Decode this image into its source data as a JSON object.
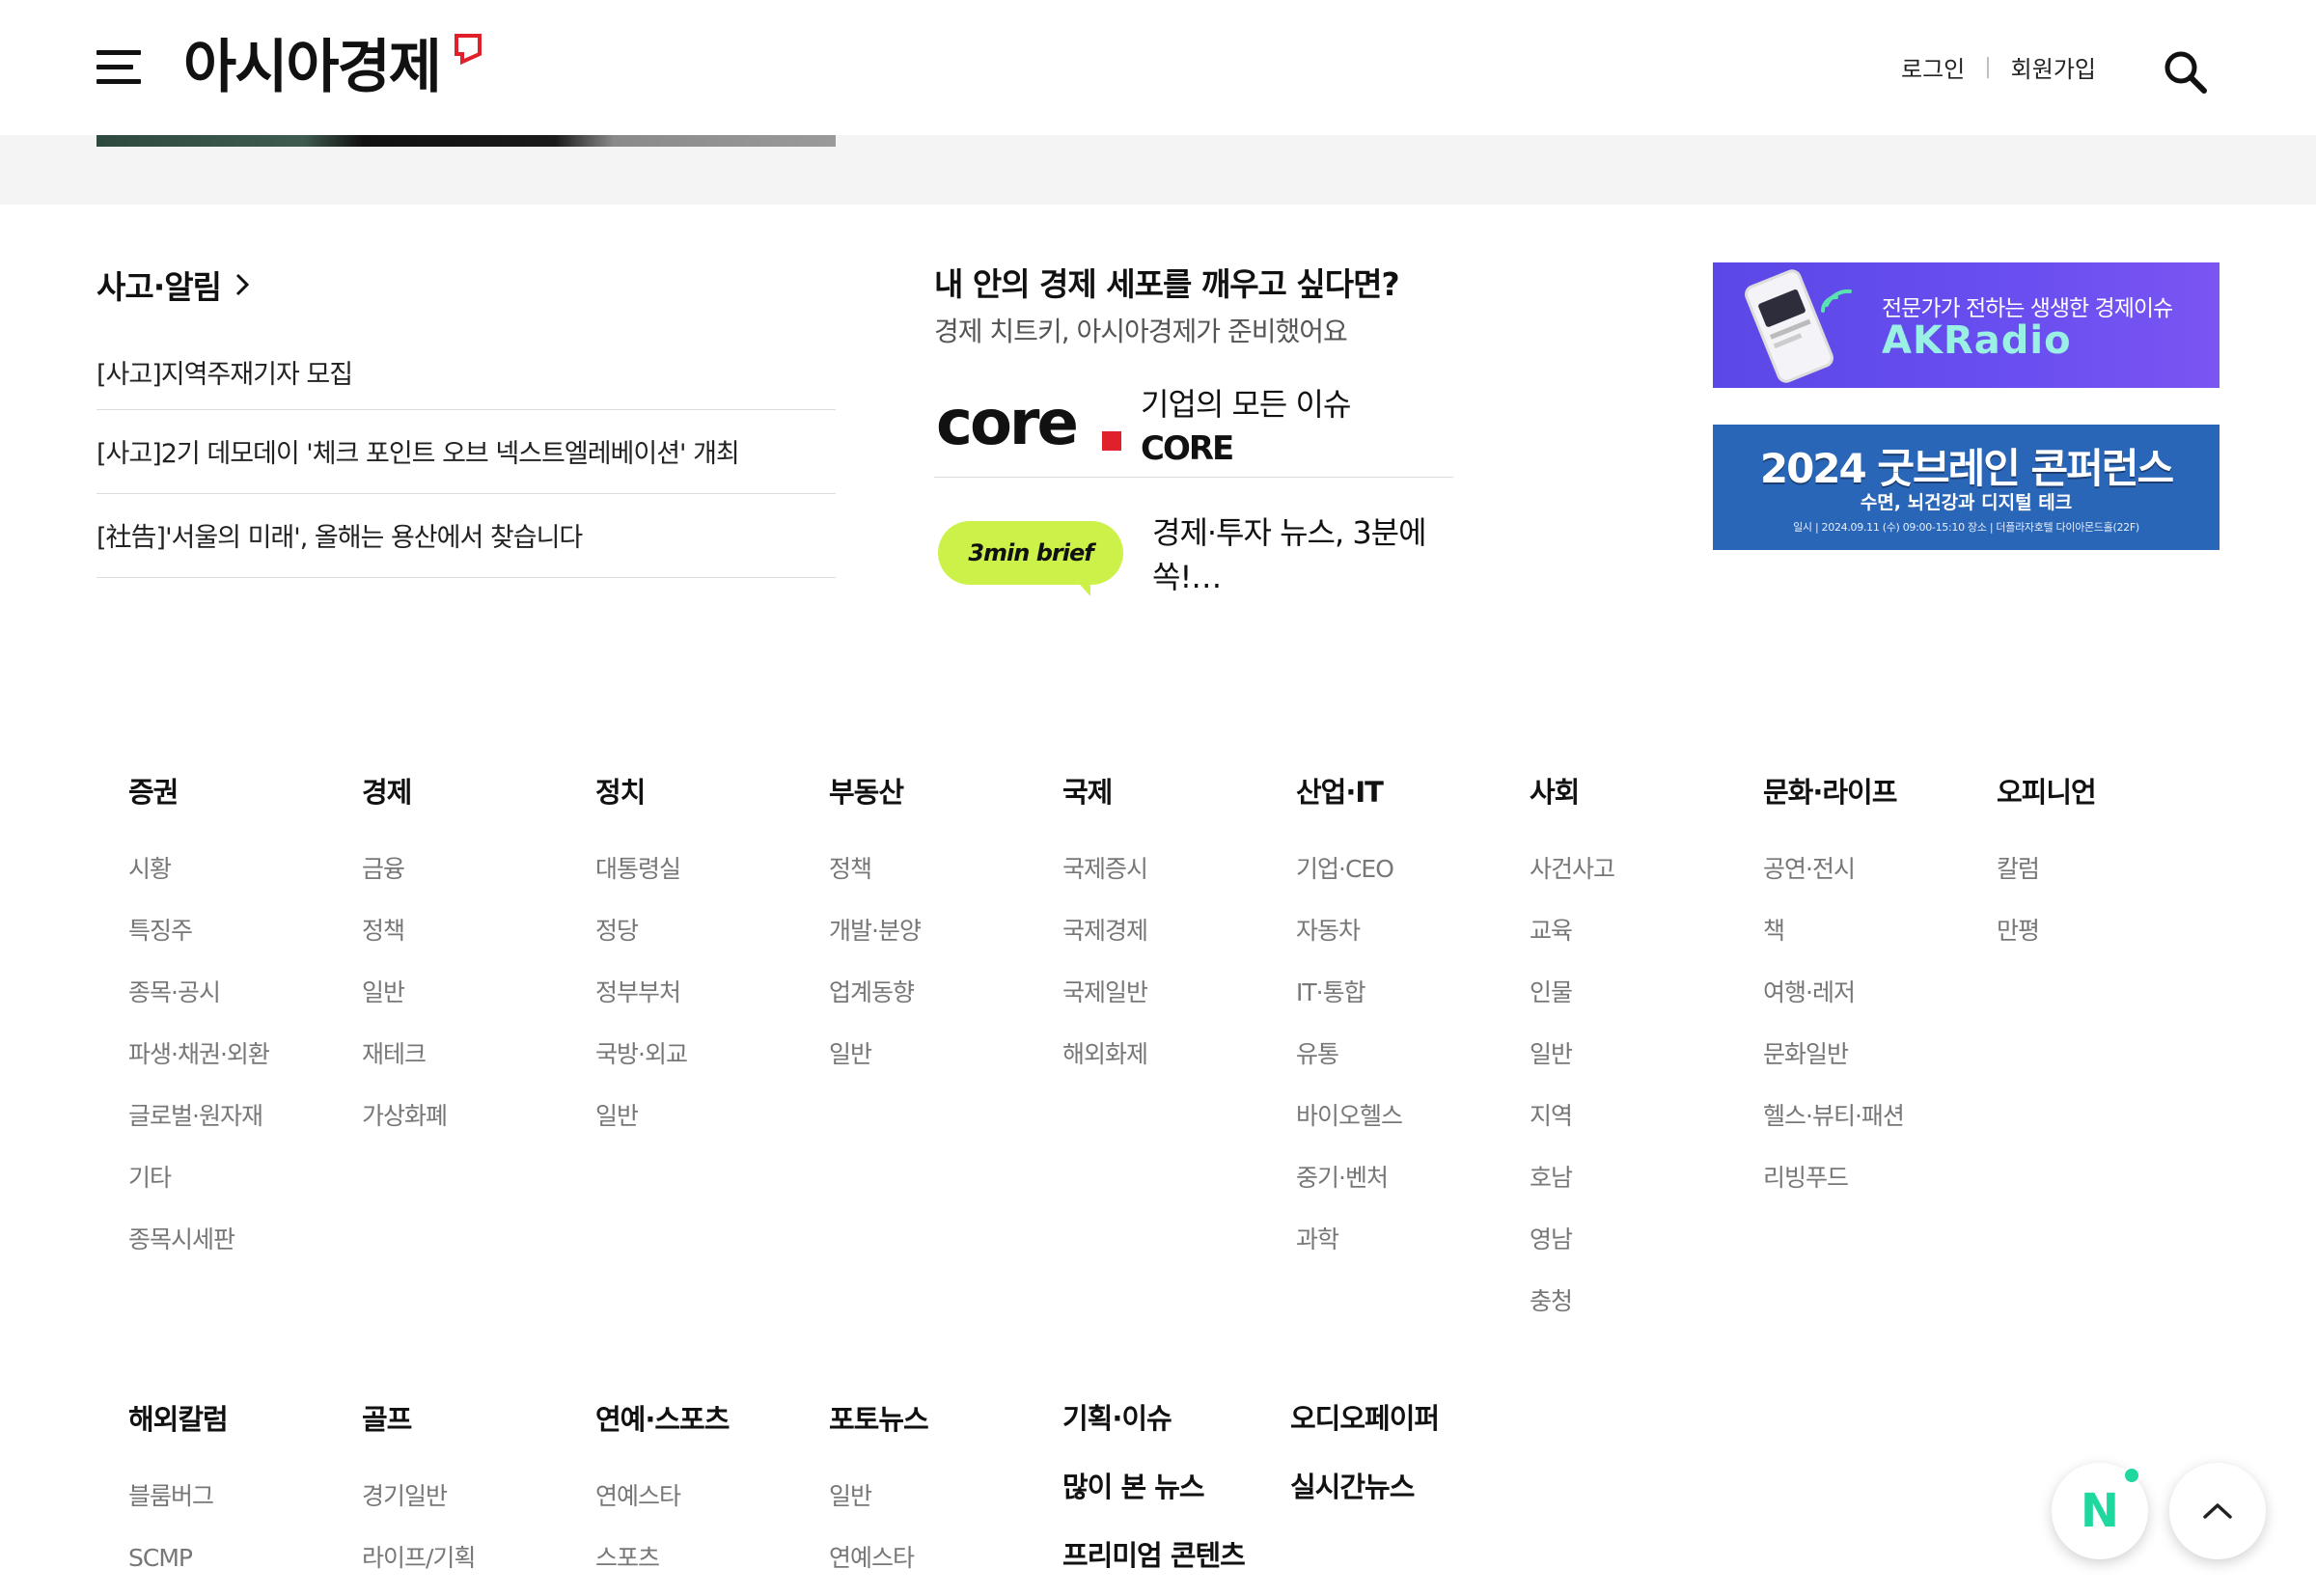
{
  "header": {
    "logo": "아시아경제",
    "login": "로그인",
    "signup": "회원가입"
  },
  "notice": {
    "title": "사고·알림",
    "items": [
      "[사고]지역주재기자 모집",
      "[사고]2기 데모데이 '체크 포인트 오브 넥스트엘레베이션' 개최",
      "[社告]'서울의 미래', 올해는 용산에서 찾습니다"
    ]
  },
  "promo": {
    "title": "내 안의 경제 세포를 깨우고 싶다면?",
    "subtitle": "경제 치트키, 아시아경제가 준비했어요",
    "core": {
      "logo": "core",
      "line1": "기업의 모든 이슈",
      "line2": "CORE"
    },
    "brief": {
      "logo": "3min brief",
      "text": "경제·투자 뉴스, 3분에 쏙!…"
    }
  },
  "banners": {
    "akradio": {
      "line1": "전문가가 전하는 생생한 경제이슈",
      "line2": "AKRadio"
    },
    "conference": {
      "title": "2024 굿브레인 콘퍼런스",
      "subtitle": "수면, 뇌건강과 디지털 테크",
      "info": "일시 | 2024.09.11 (수) 09:00-15:10      장소 | 더플라자호텔 다이아몬드홀(22F)"
    }
  },
  "sitemap": {
    "row1": [
      {
        "head": "증권",
        "items": [
          "시황",
          "특징주",
          "종목·공시",
          "파생·채권·외환",
          "글로벌·원자재",
          "기타",
          "종목시세판"
        ]
      },
      {
        "head": "경제",
        "items": [
          "금융",
          "정책",
          "일반",
          "재테크",
          "가상화폐"
        ]
      },
      {
        "head": "정치",
        "items": [
          "대통령실",
          "정당",
          "정부부처",
          "국방·외교",
          "일반"
        ]
      },
      {
        "head": "부동산",
        "items": [
          "정책",
          "개발·분양",
          "업계동향",
          "일반"
        ]
      },
      {
        "head": "국제",
        "items": [
          "국제증시",
          "국제경제",
          "국제일반",
          "해외화제"
        ]
      },
      {
        "head": "산업·IT",
        "items": [
          "기업·CEO",
          "자동차",
          "IT·통합",
          "유통",
          "바이오헬스",
          "중기·벤처",
          "과학"
        ]
      },
      {
        "head": "사회",
        "items": [
          "사건사고",
          "교육",
          "인물",
          "일반",
          "지역",
          "호남",
          "영남",
          "충청"
        ]
      },
      {
        "head": "문화·라이프",
        "items": [
          "공연·전시",
          "책",
          "여행·레저",
          "문화일반",
          "헬스·뷰티·패션",
          "리빙푸드"
        ]
      },
      {
        "head": "오피니언",
        "items": [
          "칼럼",
          "만평"
        ]
      }
    ],
    "row2": [
      {
        "head": "해외칼럼",
        "items": [
          "블룸버그",
          "SCMP"
        ]
      },
      {
        "head": "골프",
        "items": [
          "경기일반",
          "라이프/기획"
        ]
      },
      {
        "head": "연예·스포츠",
        "items": [
          "연예스타",
          "스포츠"
        ]
      },
      {
        "head": "포토뉴스",
        "items": [
          "일반",
          "연예스타"
        ]
      }
    ],
    "extra": {
      "planning": "기획·이슈",
      "audio": "오디오페이퍼",
      "most_viewed": "많이 본 뉴스",
      "realtime": "실시간뉴스",
      "premium": "프리미엄 콘텐츠"
    }
  },
  "floating": {
    "n_badge": "N"
  }
}
